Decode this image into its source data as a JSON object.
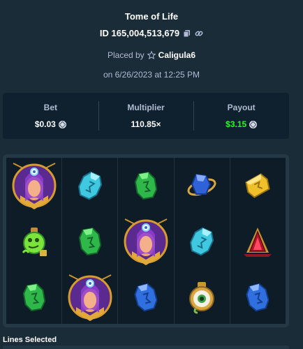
{
  "header": {
    "title": "Tome of Life",
    "bet_id": "ID 165,004,513,679",
    "placed_by_label": "Placed by",
    "username": "Caligula6",
    "date": "on 6/26/2023 at 12:25 PM"
  },
  "stats": {
    "bet_label": "Bet",
    "bet_value": "$0.03",
    "multiplier_label": "Multiplier",
    "multiplier_value": "110.85×",
    "payout_label": "Payout",
    "payout_value": "$3.15"
  },
  "reels": [
    [
      "sorceress-wild",
      "green-potion",
      "green-gem"
    ],
    [
      "cyan-gem",
      "green-gem",
      "sorceress-wild"
    ],
    [
      "green-gem",
      "sorceress-wild",
      "blue-gem"
    ],
    [
      "blue-orb",
      "cyan-gem",
      "eye-amulet"
    ],
    [
      "yellow-gem",
      "red-crystal",
      "blue-gem"
    ]
  ],
  "footer": {
    "lines_label": "Lines Selected"
  },
  "colors": {
    "background": "#1a2c38",
    "card": "#0f212e",
    "payout_green": "#1fff20",
    "text_muted": "#b1bad3"
  }
}
